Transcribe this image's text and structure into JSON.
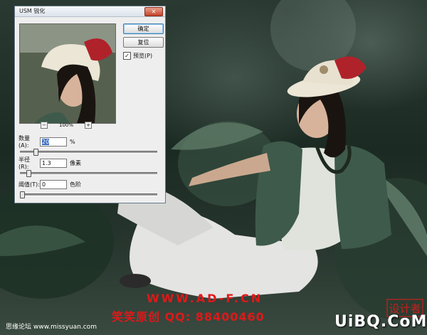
{
  "dialog": {
    "title": "USM 锐化",
    "close_label": "✕",
    "ok_label": "确定",
    "reset_label": "复位",
    "preview_label": "预览(P)",
    "preview_checked": true,
    "zoom_minus": "−",
    "zoom_plus": "+",
    "zoom_level": "100%",
    "amount": {
      "label": "数量(A):",
      "value": "20",
      "unit": "%",
      "slider": 0.1
    },
    "radius": {
      "label": "半径(R):",
      "value": "1.3",
      "unit": "像素",
      "slider": 0.05
    },
    "threshold": {
      "label": "阈值(T):",
      "value": "0",
      "unit": "色阶",
      "slider": 0.0
    }
  },
  "watermark": {
    "url": "WWW.AD-F.CN",
    "qq": "笑笑原创 QQ: 88400460",
    "site": "思缘论坛 www.missyuan.com",
    "logo": "UiBQ.CoM",
    "stamp": "设计者"
  },
  "colors": {
    "watermark_red": "#e01818",
    "hat_red": "#b0222a",
    "jacket": "#3e5a4a"
  },
  "icons": {
    "checkbox": "checkmark-icon",
    "close": "close-icon"
  }
}
